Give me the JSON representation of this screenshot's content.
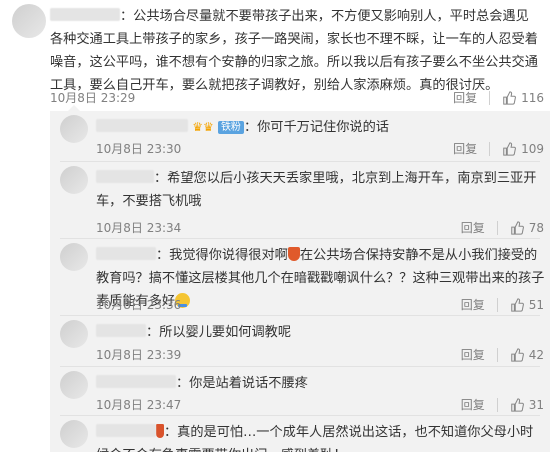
{
  "main": {
    "text": "：公共场合尽量就不要带孩子出来，不方便又影响别人，平时总会遇见各种交通工具上带孩子的家乡，孩子一路哭闹，家长也不理不睬，让一车的人忍受着噪音，这公平吗，谁不想有个安静的归家之旅。所以我以后有孩子要么不坐公共交通工具，要么自己开车，要么就把孩子调教好，别给人家添麻烦。真的很讨厌。",
    "time": "10月8日 23:29",
    "reply_label": "回复",
    "likes": "116"
  },
  "replies": [
    {
      "text": "：你可千万记住你说的话",
      "badge": "铁粉",
      "time": "10月8日 23:30",
      "reply_label": "回复",
      "likes": "109"
    },
    {
      "text": "：希望您以后小孩天天丢家里哦，北京到上海开车，南京到三亚开车，不要搭飞机哦",
      "time": "10月8日 23:34",
      "reply_label": "回复",
      "likes": "78"
    },
    {
      "text_a": "：我觉得你说得很对啊",
      "text_b": "在公共场合保持安静不是从小我们接受的教育吗？搞不懂这层楼其他几个在暗戳戳嘲讽什么？？这种三观带出来的孩子素质能有多好",
      "time": "10月8日 23:36",
      "reply_label": "回复",
      "likes": "51"
    },
    {
      "text": "：所以婴儿要如何调教呢",
      "time": "10月8日 23:39",
      "reply_label": "回复",
      "likes": "42"
    },
    {
      "text": "：你是站着说话不腰疼",
      "time": "10月8日 23:47",
      "reply_label": "回复",
      "likes": "31"
    },
    {
      "text": "：真的是可怕…一个成年人居然说出这话，也不知道你父母小时候会不会有急事需要带你出门，感到羞耻！"
    }
  ],
  "icons": {
    "like": "thumbs-up-icon",
    "emoji": "smile-emoji-icon"
  },
  "colors": {
    "meta": "#808080",
    "reply_bg": "#f2f2f2",
    "badge": "#5aa3e0",
    "vip": "#f4a300"
  }
}
